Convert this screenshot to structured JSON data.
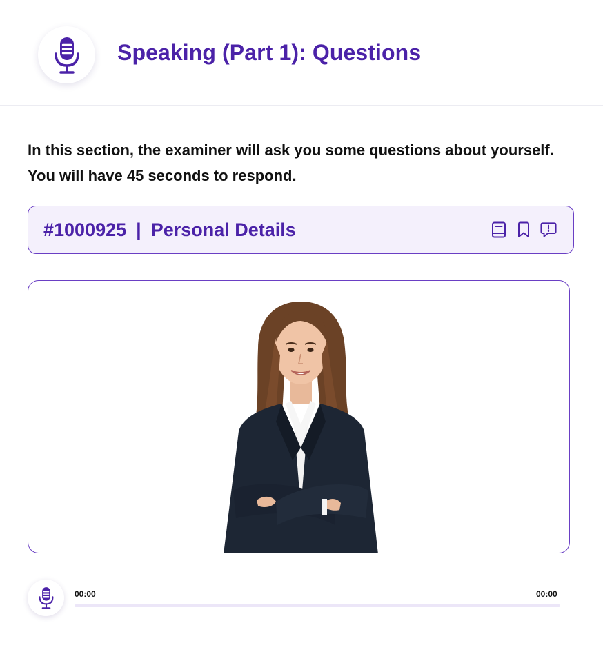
{
  "header": {
    "title": "Speaking (Part 1): Questions",
    "icon": "microphone-icon"
  },
  "instructions": {
    "text": "In this section, the examiner will ask you some questions about yourself. You will have 45 seconds to respond."
  },
  "question": {
    "id": "#1000925",
    "separator": "|",
    "topic": "Personal Details",
    "tools": [
      "book-icon",
      "bookmark-icon",
      "report-icon"
    ]
  },
  "video": {
    "subject": "examiner-portrait"
  },
  "player": {
    "current_time": "00:00",
    "total_time": "00:00",
    "progress": 0,
    "icon": "microphone-icon"
  },
  "colors": {
    "accent": "#4b22a8",
    "border": "#6a3fc4",
    "bar_background": "#f4f0fc",
    "track": "#ece6f8"
  }
}
